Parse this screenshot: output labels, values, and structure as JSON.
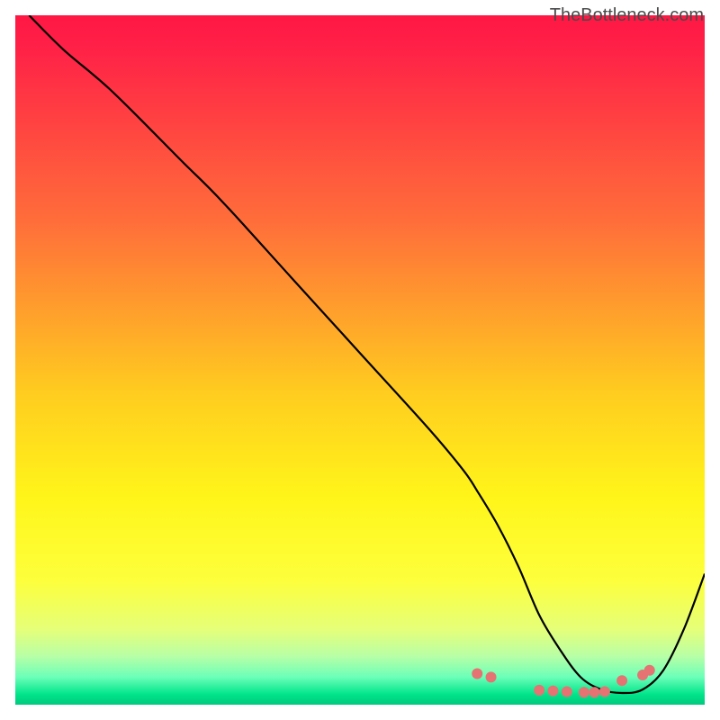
{
  "watermark": "TheBottleneck.com",
  "chart_data": {
    "type": "line",
    "title": "",
    "xlabel": "",
    "ylabel": "",
    "xlim": [
      0,
      100
    ],
    "ylim": [
      0,
      100
    ],
    "gradient_stops": [
      {
        "offset": 0,
        "color": "#ff1744"
      },
      {
        "offset": 4,
        "color": "#ff1f47"
      },
      {
        "offset": 30,
        "color": "#ff6e3a"
      },
      {
        "offset": 55,
        "color": "#ffcd1f"
      },
      {
        "offset": 70,
        "color": "#fff51a"
      },
      {
        "offset": 82,
        "color": "#fdff3c"
      },
      {
        "offset": 89,
        "color": "#e6ff78"
      },
      {
        "offset": 93,
        "color": "#b7ffa6"
      },
      {
        "offset": 96,
        "color": "#6cffb8"
      },
      {
        "offset": 98.5,
        "color": "#00e58a"
      },
      {
        "offset": 100,
        "color": "#00c97e"
      }
    ],
    "series": [
      {
        "name": "bottleneck-curve",
        "x": [
          2,
          7,
          14,
          24,
          30,
          40,
          50,
          60,
          65,
          67,
          70,
          73,
          76,
          79,
          82,
          85,
          88,
          91,
          94,
          97,
          100
        ],
        "y": [
          100,
          95,
          89,
          79,
          73,
          62,
          51,
          40,
          34,
          31,
          26,
          20,
          13,
          8,
          4,
          2.2,
          1.7,
          2.2,
          5,
          11,
          19
        ]
      }
    ],
    "markers": {
      "name": "highlight-points",
      "x": [
        67,
        69,
        76,
        78,
        80,
        82.5,
        84,
        85.5,
        88,
        91,
        92
      ],
      "y": [
        4.5,
        4,
        2.1,
        2,
        1.9,
        1.8,
        1.8,
        1.9,
        3.5,
        4.3,
        5
      ],
      "color": "#e57373",
      "radius": 6
    }
  }
}
